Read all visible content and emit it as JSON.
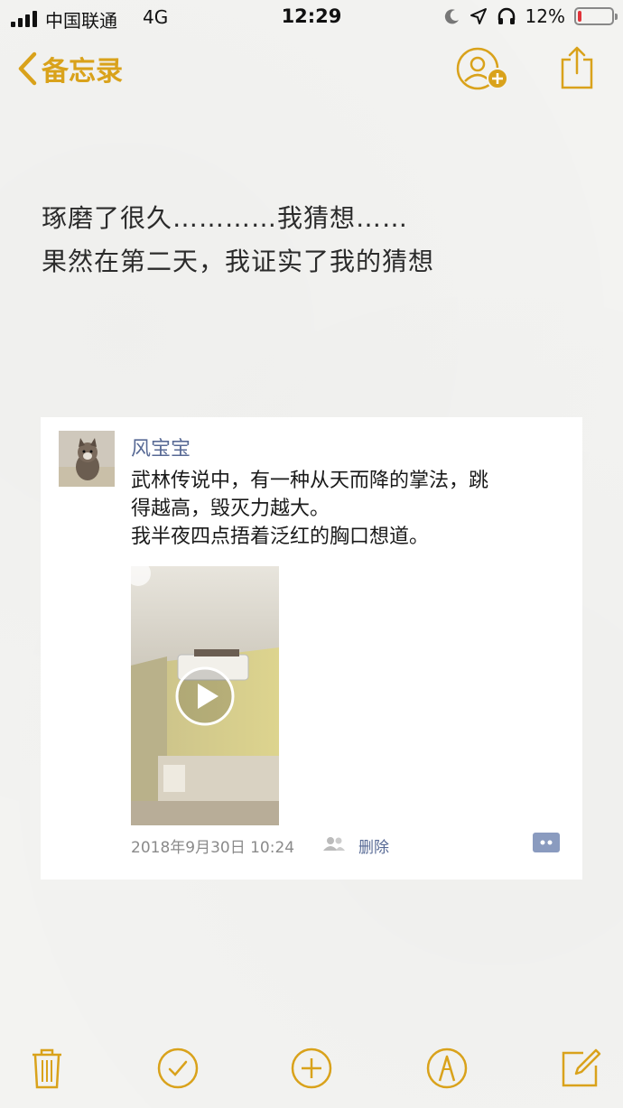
{
  "status_bar": {
    "carrier": "中国联通",
    "network": "4G",
    "time": "12:29",
    "battery_percent_label": "12%",
    "battery_level": 0.12,
    "icons": [
      "moon-icon",
      "location-arrow-icon",
      "headphones-icon",
      "battery-icon"
    ]
  },
  "nav": {
    "back_label": "备忘录",
    "icons": [
      "add-person-icon",
      "share-icon"
    ]
  },
  "note": {
    "line1": "琢磨了很久…………我猜想……",
    "line2": "果然在第二天，我证实了我的猜想"
  },
  "post": {
    "author": "风宝宝",
    "text_line1": "武林传说中，有一种从天而降的掌法，跳",
    "text_line2": "得越高，毁灭力越大。",
    "text_line3": "我半夜四点捂着泛红的胸口想道。",
    "timestamp": "2018年9月30日 10:24",
    "delete_label": "删除"
  },
  "toolbar": {
    "icons": [
      "trash-icon",
      "checklist-icon",
      "add-icon",
      "markup-icon",
      "compose-icon"
    ]
  },
  "colors": {
    "accent": "#d9a21b",
    "link": "#586a95",
    "paper": "#f3f3f1"
  }
}
